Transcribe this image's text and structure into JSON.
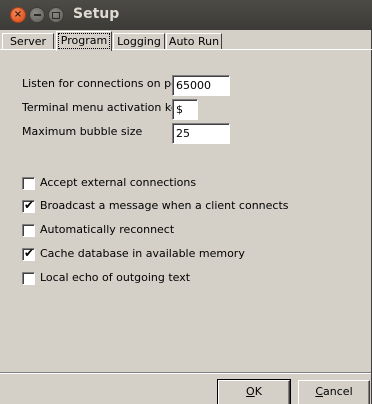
{
  "window": {
    "title": "Setup",
    "close_glyph": "×",
    "min_icon": "minimize-icon",
    "max_icon": "maximize-icon"
  },
  "tabs": [
    {
      "label": "Server",
      "active": false
    },
    {
      "label": "Program",
      "active": true
    },
    {
      "label": "Logging",
      "active": false
    },
    {
      "label": "Auto Run",
      "active": false
    }
  ],
  "fields": {
    "port": {
      "label": "Listen for connections on port",
      "value": "65000"
    },
    "menu_key": {
      "label": "Terminal menu activation key",
      "value": "$"
    },
    "bubble": {
      "label": "Maximum bubble size",
      "value": "25"
    }
  },
  "options": [
    {
      "label": "Accept external connections",
      "checked": false
    },
    {
      "label": "Broadcast a message when a client connects",
      "checked": true
    },
    {
      "label": "Automatically reconnect",
      "checked": false
    },
    {
      "label": "Cache database in available memory",
      "checked": true
    },
    {
      "label": "Local echo of outgoing text",
      "checked": false
    }
  ],
  "buttons": {
    "ok": {
      "mnemonic": "O",
      "rest": "K"
    },
    "cancel": {
      "mnemonic": "C",
      "rest": "ancel"
    }
  },
  "colors": {
    "titlebar": "#3c3b37",
    "close_button": "#e05a26",
    "dialog_face": "#d4d0c8"
  }
}
